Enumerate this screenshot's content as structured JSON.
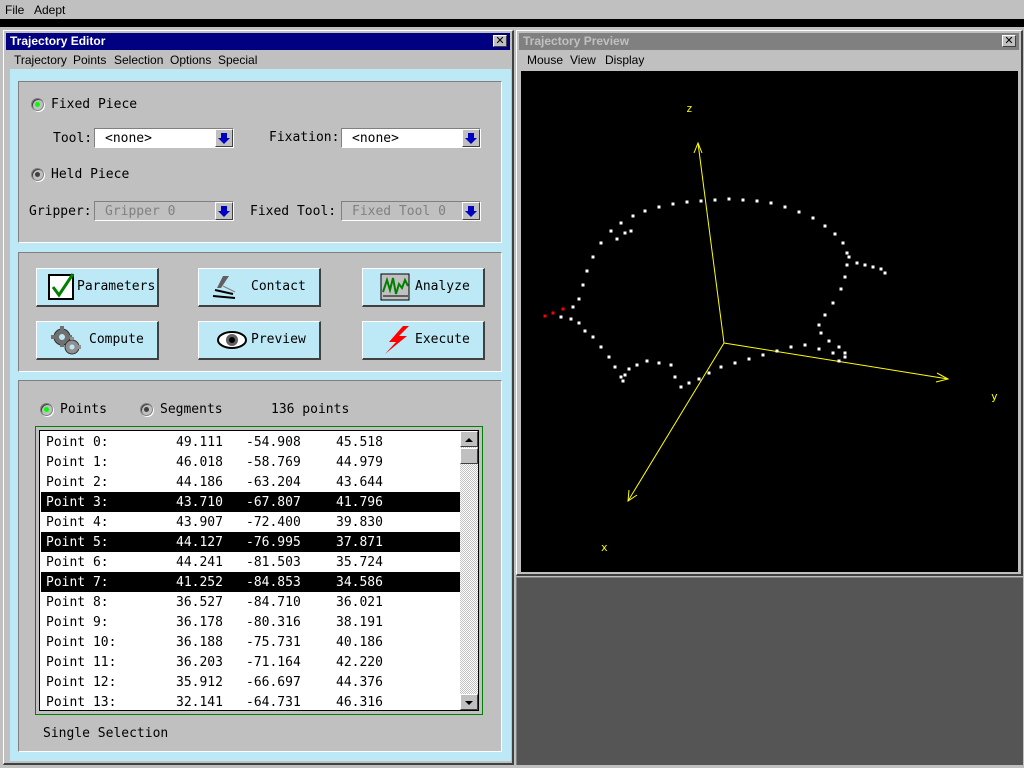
{
  "app_menu": {
    "file": "File",
    "adept": "Adept"
  },
  "editor": {
    "title": "Trajectory Editor",
    "menu": [
      "Trajectory",
      "Points",
      "Selection",
      "Options",
      "Special"
    ],
    "fixed_piece": {
      "label": "Fixed Piece",
      "selected": true,
      "tool_label": "Tool:",
      "tool_value": "<none>",
      "fixation_label": "Fixation:",
      "fixation_value": "<none>"
    },
    "held_piece": {
      "label": "Held Piece",
      "selected": false,
      "gripper_label": "Gripper:",
      "gripper_value": "Gripper 0",
      "fixed_tool_label": "Fixed Tool:",
      "fixed_tool_value": "Fixed Tool 0"
    },
    "buttons": {
      "parameters": "Parameters",
      "contact": "Contact",
      "analyze": "Analyze",
      "compute": "Compute",
      "preview": "Preview",
      "execute": "Execute"
    },
    "view_mode": {
      "points": "Points",
      "segments": "Segments",
      "selected": "Points",
      "count": "136 points"
    },
    "points": [
      {
        "name": "Point 0:",
        "x": "49.111",
        "y": "-54.908",
        "z": "45.518",
        "selected": false
      },
      {
        "name": "Point 1:",
        "x": "46.018",
        "y": "-58.769",
        "z": "44.979",
        "selected": false
      },
      {
        "name": "Point 2:",
        "x": "44.186",
        "y": "-63.204",
        "z": "43.644",
        "selected": false
      },
      {
        "name": "Point 3:",
        "x": "43.710",
        "y": "-67.807",
        "z": "41.796",
        "selected": true
      },
      {
        "name": "Point 4:",
        "x": "43.907",
        "y": "-72.400",
        "z": "39.830",
        "selected": false
      },
      {
        "name": "Point 5:",
        "x": "44.127",
        "y": "-76.995",
        "z": "37.871",
        "selected": true
      },
      {
        "name": "Point 6:",
        "x": "44.241",
        "y": "-81.503",
        "z": "35.724",
        "selected": false
      },
      {
        "name": "Point 7:",
        "x": "41.252",
        "y": "-84.853",
        "z": "34.586",
        "selected": true
      },
      {
        "name": "Point 8:",
        "x": "36.527",
        "y": "-84.710",
        "z": "36.021",
        "selected": false
      },
      {
        "name": "Point 9:",
        "x": "36.178",
        "y": "-80.316",
        "z": "38.191",
        "selected": false
      },
      {
        "name": "Point 10:",
        "x": "36.188",
        "y": "-75.731",
        "z": "40.186",
        "selected": false
      },
      {
        "name": "Point 11:",
        "x": "36.203",
        "y": "-71.164",
        "z": "42.220",
        "selected": false
      },
      {
        "name": "Point 12:",
        "x": "35.912",
        "y": "-66.697",
        "z": "44.376",
        "selected": false
      },
      {
        "name": "Point 13:",
        "x": "32.141",
        "y": "-64.731",
        "z": "46.316",
        "selected": false
      }
    ],
    "selection_mode": "Single Selection"
  },
  "preview": {
    "title": "Trajectory Preview",
    "menu": [
      "Mouse",
      "View",
      "Display"
    ],
    "axis_labels": {
      "z": "z",
      "y": "y",
      "x": "x"
    }
  },
  "colors": {
    "editor_title_bg": "#000080",
    "preview_title_bg": "#808080",
    "panel_frame": "#bde9f7",
    "radio_on": "#00ff00",
    "axis": "#ffff00",
    "trajectory": "#ffffff",
    "trajectory_start": "#ff0000"
  },
  "icons": {
    "parameters": "checkmark-icon",
    "contact": "contact-icon",
    "analyze": "graph-icon",
    "compute": "gears-icon",
    "preview": "eye-icon",
    "execute": "lightning-icon"
  }
}
